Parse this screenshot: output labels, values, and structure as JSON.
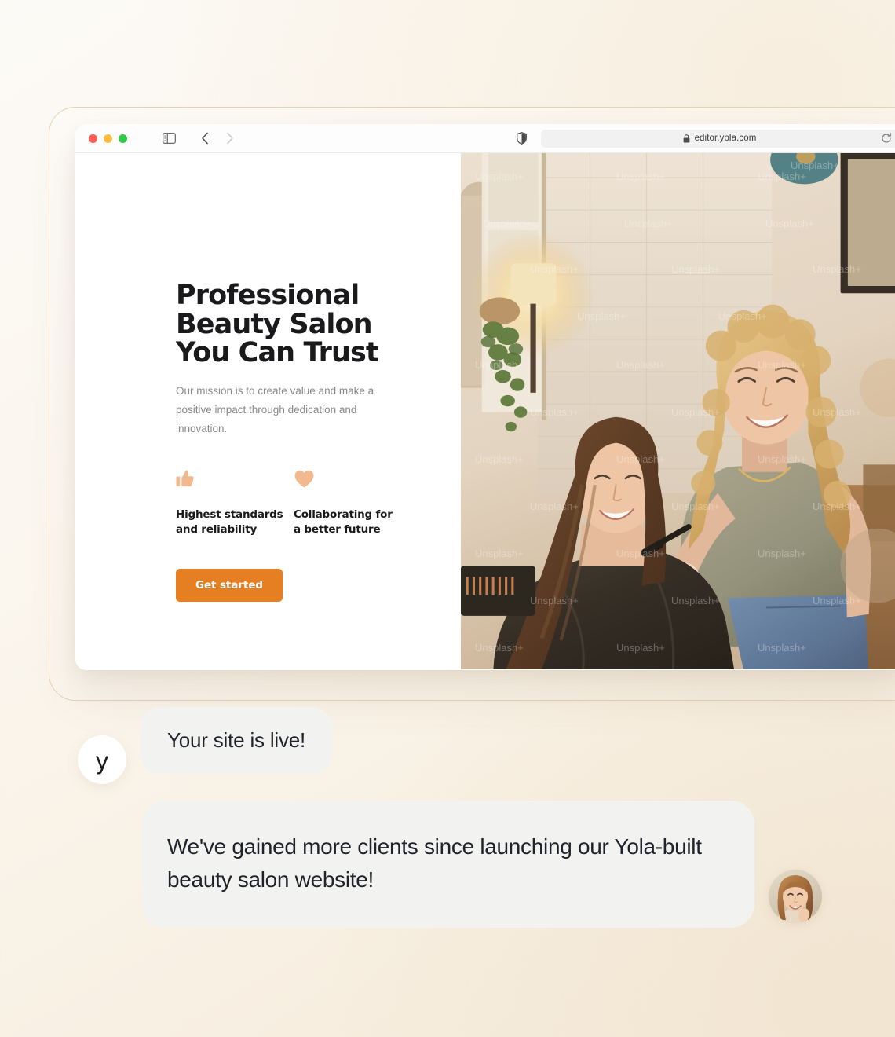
{
  "browser": {
    "url": "editor.yola.com",
    "lock_icon": "lock-icon",
    "reload_icon": "reload-icon",
    "sidebar_icon": "sidebar-toggle-icon",
    "back_icon": "chevron-left-icon",
    "forward_icon": "chevron-right-icon",
    "shield_icon": "shield-icon",
    "traffic_lights": [
      "close-red",
      "minimize-yellow",
      "maximize-green"
    ]
  },
  "hero": {
    "title": "Professional\nBeauty Salon\nYou Can Trust",
    "subtitle": "Our mission is to create value and make a positive impact through dedication and innovation.",
    "cta_label": "Get started",
    "accent_color": "#E67E22",
    "icon_color": "#F2B98F",
    "features": [
      {
        "icon": "thumbs-up-icon",
        "label": "Highest standards\nand reliability"
      },
      {
        "icon": "heart-icon",
        "label": "Collaborating for\na better future"
      }
    ],
    "photo_alt": "Hair stylist smiling while cutting a seated client's hair in a salon",
    "photo_watermark": "Unsplash+"
  },
  "chat": {
    "messages": [
      {
        "avatar": "yola-logo-avatar",
        "avatar_mark": "y",
        "text": "Your site is live!"
      },
      {
        "avatar": "user-photo-avatar",
        "text": "We've gained more clients since launching our Yola-built beauty salon website!"
      }
    ],
    "bubble_color": "#F2F2F1"
  }
}
